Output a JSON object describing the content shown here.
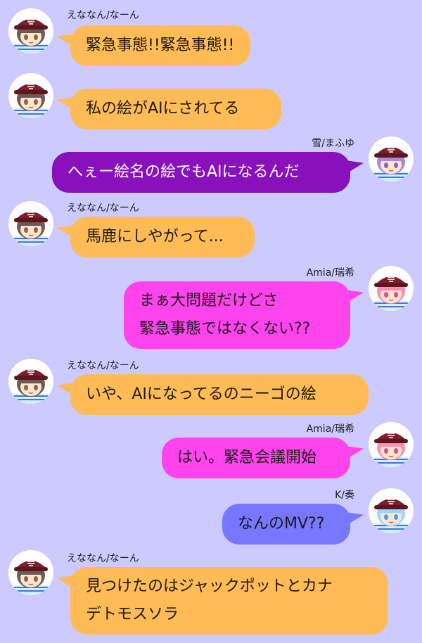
{
  "messages": [
    {
      "side": "left",
      "speaker": "えななん/なーん",
      "show_name": true,
      "color": "orange",
      "avatar": "ena-avatar",
      "lines": [
        "緊急事態!!緊急事態!!"
      ]
    },
    {
      "side": "left",
      "speaker": "",
      "show_name": false,
      "color": "orange",
      "avatar": "ena-avatar",
      "lines": [
        "私の絵がAIにされてる"
      ]
    },
    {
      "side": "right",
      "speaker": "雪/まふゆ",
      "show_name": true,
      "color": "purple",
      "avatar": "mafuyu-avatar",
      "lines": [
        "へぇー絵名の絵でもAIになるんだ"
      ]
    },
    {
      "side": "left",
      "speaker": "えななん/なーん",
      "show_name": true,
      "color": "orange",
      "avatar": "ena-avatar",
      "lines": [
        "馬鹿にしやがって..."
      ]
    },
    {
      "side": "right",
      "speaker": "Amia/瑞希",
      "show_name": true,
      "color": "pink",
      "avatar": "mizuki-avatar",
      "lines": [
        "まぁ大問題だけどさ",
        "緊急事態ではなくない??"
      ]
    },
    {
      "side": "left",
      "speaker": "えななん/なーん",
      "show_name": true,
      "color": "orange",
      "avatar": "ena-avatar",
      "lines": [
        "いや、AIになってるのニーゴの絵"
      ]
    },
    {
      "side": "right",
      "speaker": "Amia/瑞希",
      "show_name": true,
      "color": "pink",
      "avatar": "mizuki-avatar",
      "lines": [
        "はい。緊急会議開始"
      ]
    },
    {
      "side": "right",
      "speaker": "K/奏",
      "show_name": true,
      "color": "blue",
      "avatar": "kanade-avatar",
      "lines": [
        "なんのMV??"
      ]
    },
    {
      "side": "left",
      "speaker": "えななん/なーん",
      "show_name": true,
      "color": "orange",
      "avatar": "ena-avatar",
      "lines": [
        "見つけたのはジャックポットとカナ",
        "デトモスソラ"
      ]
    }
  ],
  "colors": {
    "background": "#cccaff",
    "orange": "#ffbb55",
    "purple": "#8811bb",
    "pink": "#ff44ee",
    "blue": "#7777ff"
  }
}
